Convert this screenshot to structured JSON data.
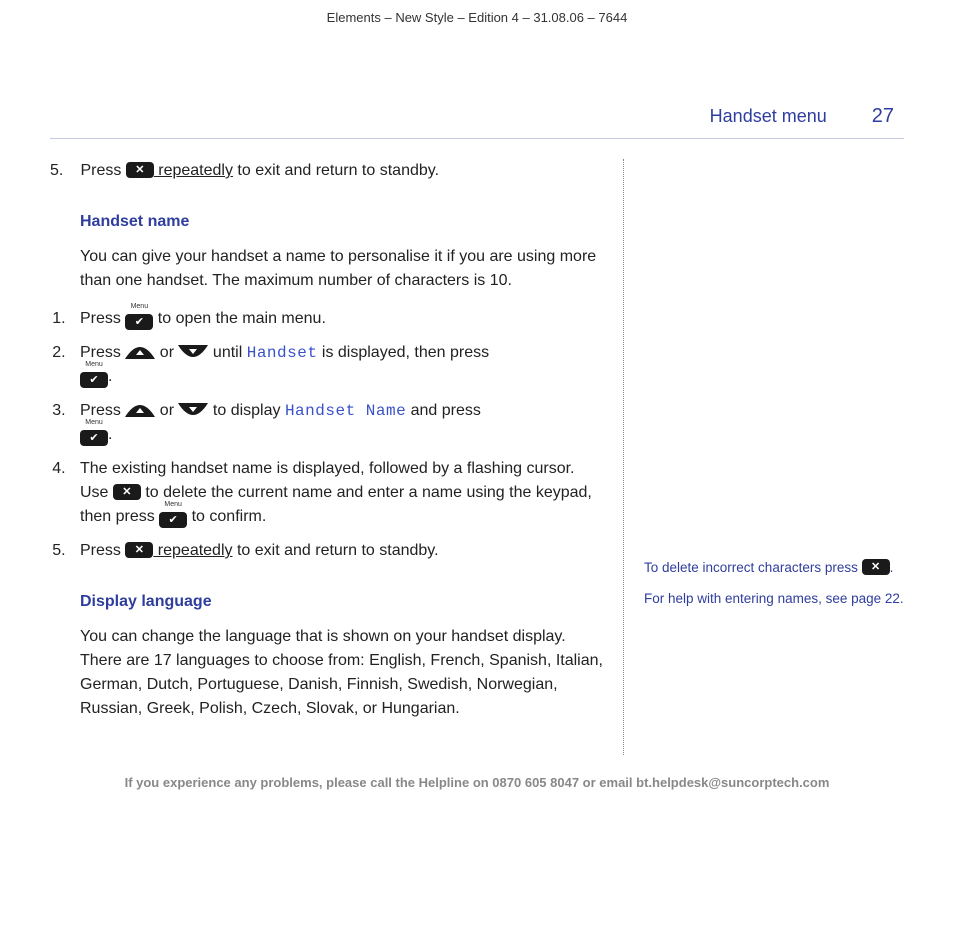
{
  "print_header": "Elements – New Style – Edition 4 – 31.08.06 – 7644",
  "header": {
    "section": "Handset menu",
    "page": "27"
  },
  "intro_step5_a": "Press ",
  "intro_step5_b": " repeatedly",
  "intro_step5_c": " to exit and return to standby.",
  "handset_name": {
    "heading": "Handset name",
    "intro": "You can give your handset a name to personalise it if you are using more than one handset. The maximum number of characters is 10.",
    "s1_a": "Press ",
    "s1_b": " to open the main menu.",
    "s2_a": "Press ",
    "s2_or": " or ",
    "s2_b": " until ",
    "s2_lcd": "Handset",
    "s2_c": " is displayed, then press ",
    "s3_a": "Press ",
    "s3_or": " or ",
    "s3_b": " to display ",
    "s3_lcd": "Handset Name",
    "s3_c": " and press ",
    "s4_a": "The existing handset name is displayed, followed by a flashing cursor. Use ",
    "s4_b": " to delete the current name and enter a name using the keypad, then press ",
    "s4_c": " to confirm.",
    "s5_a": "Press ",
    "s5_b": " repeatedly",
    "s5_c": " to exit and return to standby."
  },
  "display_language": {
    "heading": "Display language",
    "intro": "You can change the language that is shown on your handset display. There are 17 languages to choose from: English, French, Spanish, Italian, German, Dutch, Portuguese, Danish, Finnish, Swedish, Norwegian, Russian, Greek, Polish, Czech, Slovak, or Hungarian."
  },
  "sidebar": {
    "tip1_a": "To delete incorrect characters press ",
    "tip1_b": ".",
    "tip2": "For help with entering names, see page 22."
  },
  "menu_label": "Menu",
  "footer": "If you experience any problems, please call the Helpline on 0870 605 8047 or email bt.helpdesk@suncorptech.com"
}
